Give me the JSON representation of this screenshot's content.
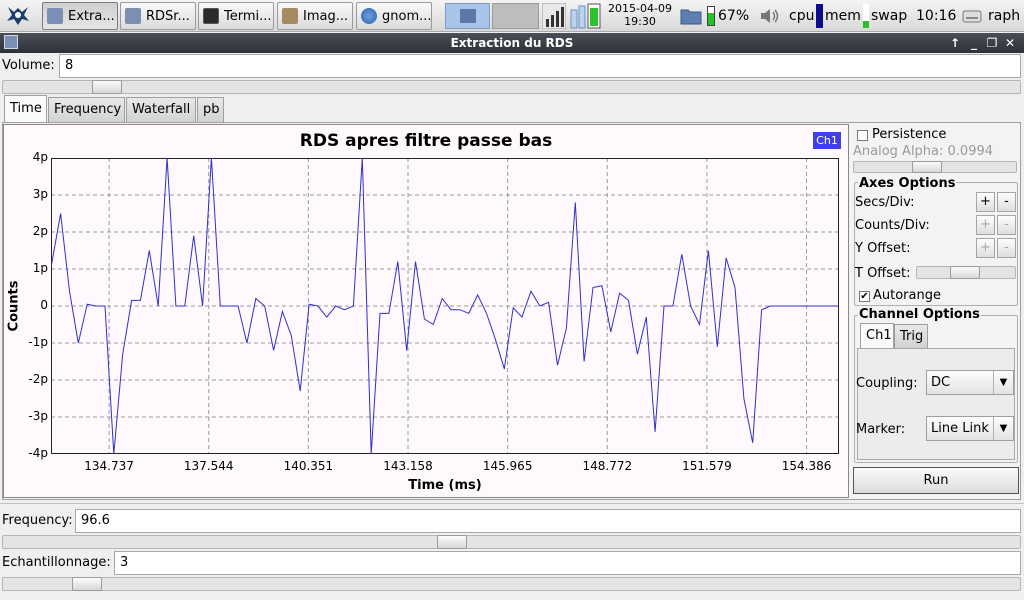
{
  "taskbar": {
    "tasks": [
      {
        "label": "Extra..."
      },
      {
        "label": "RDSr..."
      },
      {
        "label": "Termi..."
      },
      {
        "label": "Imag..."
      },
      {
        "label": "gnom..."
      }
    ],
    "datetime": {
      "date": "2015-04-09",
      "time": "19:30"
    },
    "battery_percent": "67%",
    "cpu_label": "cpu",
    "mem_label": "mem",
    "swap_label": "swap",
    "clock": "10:16",
    "user": "raph"
  },
  "window": {
    "title": "Extraction du RDS"
  },
  "volume": {
    "label": "Volume:",
    "value": "8",
    "slider_level": 0.09
  },
  "tabs": [
    {
      "label": "Time",
      "selected": true
    },
    {
      "label": "Frequency",
      "selected": false
    },
    {
      "label": "Waterfall",
      "selected": false
    },
    {
      "label": "pb",
      "selected": false
    }
  ],
  "plot": {
    "legend_label": "Ch1",
    "line_color": "#3030c8"
  },
  "chart_data": {
    "type": "line",
    "title": "RDS apres filtre passe bas",
    "xlabel": "Time (ms)",
    "ylabel": "Counts",
    "xlim": [
      133.1,
      155.3
    ],
    "ylim": [
      -4,
      4
    ],
    "grid": true,
    "legend_position": "top-right",
    "yticks": [
      {
        "value": 4,
        "label": "4p"
      },
      {
        "value": 3,
        "label": "3p"
      },
      {
        "value": 2,
        "label": "2p"
      },
      {
        "value": 1,
        "label": "1p"
      },
      {
        "value": 0,
        "label": "0"
      },
      {
        "value": -1,
        "label": "-1p"
      },
      {
        "value": -2,
        "label": "-2p"
      },
      {
        "value": -3,
        "label": "-3p"
      },
      {
        "value": -4,
        "label": "-4p"
      }
    ],
    "xticks": [
      {
        "value": 134.737,
        "label": "134.737"
      },
      {
        "value": 137.544,
        "label": "137.544"
      },
      {
        "value": 140.351,
        "label": "140.351"
      },
      {
        "value": 143.158,
        "label": "143.158"
      },
      {
        "value": 145.965,
        "label": "145.965"
      },
      {
        "value": 148.772,
        "label": "148.772"
      },
      {
        "value": 151.579,
        "label": "151.579"
      },
      {
        "value": 154.386,
        "label": "154.386"
      }
    ],
    "series": [
      {
        "x": [
          133.11,
          133.37,
          133.62,
          133.87,
          134.12,
          134.37,
          134.62,
          134.87,
          135.12,
          135.37,
          135.62,
          135.87,
          136.12,
          136.37,
          136.62,
          136.87,
          137.12,
          137.37,
          137.62,
          137.87,
          138.12,
          138.37,
          138.62,
          138.87,
          139.12,
          139.37,
          139.62,
          139.87,
          140.12,
          140.37,
          140.62,
          140.87,
          141.12,
          141.37,
          141.62,
          141.87,
          142.12,
          142.37,
          142.62,
          142.87,
          143.12,
          143.37,
          143.62,
          143.87,
          144.12,
          144.37,
          144.62,
          144.87,
          145.12,
          145.37,
          145.62,
          145.87,
          146.12,
          146.37,
          146.62,
          146.87,
          147.12,
          147.37,
          147.62,
          147.87,
          148.12,
          148.37,
          148.62,
          148.87,
          149.12,
          149.37,
          149.62,
          149.87,
          150.12,
          150.37,
          150.62,
          150.87,
          151.12,
          151.37,
          151.62,
          151.87,
          152.12,
          152.37,
          152.62,
          152.87,
          153.12,
          153.37,
          153.62,
          153.87,
          154.12,
          154.37,
          154.62,
          154.87,
          155.12,
          155.3
        ],
        "y": [
          1.1,
          2.5,
          0.4,
          -1.0,
          0.05,
          0.0,
          0.0,
          -4.0,
          -1.3,
          0.15,
          0.15,
          1.5,
          0.0,
          4.0,
          0.0,
          0.0,
          1.9,
          0.0,
          4.0,
          0.0,
          0.0,
          0.0,
          -1.0,
          0.2,
          0.0,
          -1.2,
          -0.15,
          -0.8,
          -2.3,
          0.05,
          0.0,
          -0.3,
          0.0,
          -0.1,
          0.0,
          4.0,
          -4.0,
          -0.2,
          -0.2,
          1.2,
          -1.2,
          1.2,
          -0.35,
          -0.5,
          0.2,
          -0.1,
          -0.1,
          -0.2,
          0.3,
          -0.2,
          -0.9,
          -1.7,
          -0.05,
          -0.3,
          0.4,
          0.0,
          0.1,
          -1.6,
          -0.6,
          2.8,
          -1.5,
          0.5,
          0.55,
          -0.7,
          0.35,
          0.15,
          -1.3,
          -0.3,
          -3.4,
          0.0,
          0.0,
          1.4,
          0.0,
          -0.5,
          1.5,
          -1.1,
          1.3,
          0.5,
          -2.5,
          -3.7,
          -0.1,
          0.0,
          0.0,
          0.0,
          0.0,
          0.0,
          0.0,
          0.0,
          0.0,
          0.0
        ]
      }
    ]
  },
  "side": {
    "persistence_label": "Persistence",
    "analog_alpha_label": "Analog Alpha: 0.0994",
    "axes_options_title": "Axes Options",
    "secs_div_label": "Secs/Div:",
    "counts_div_label": "Counts/Div:",
    "y_offset_label": "Y Offset:",
    "t_offset_label": "T Offset:",
    "autorange_label": "Autorange",
    "autorange_checked": true,
    "plus": "+",
    "minus": "-",
    "channel_options_title": "Channel Options",
    "channel_tabs": [
      "Ch1",
      "Trig"
    ],
    "coupling_label": "Coupling:",
    "coupling_value": "DC",
    "marker_label": "Marker:",
    "marker_value": "Line Link",
    "run_label": "Run"
  },
  "frequency": {
    "label": "Frequency:",
    "value": "96.6",
    "slider_level": 0.44
  },
  "echantillonnage": {
    "label": "Echantillonnage:",
    "value": "3",
    "slider_level": 0.07
  }
}
